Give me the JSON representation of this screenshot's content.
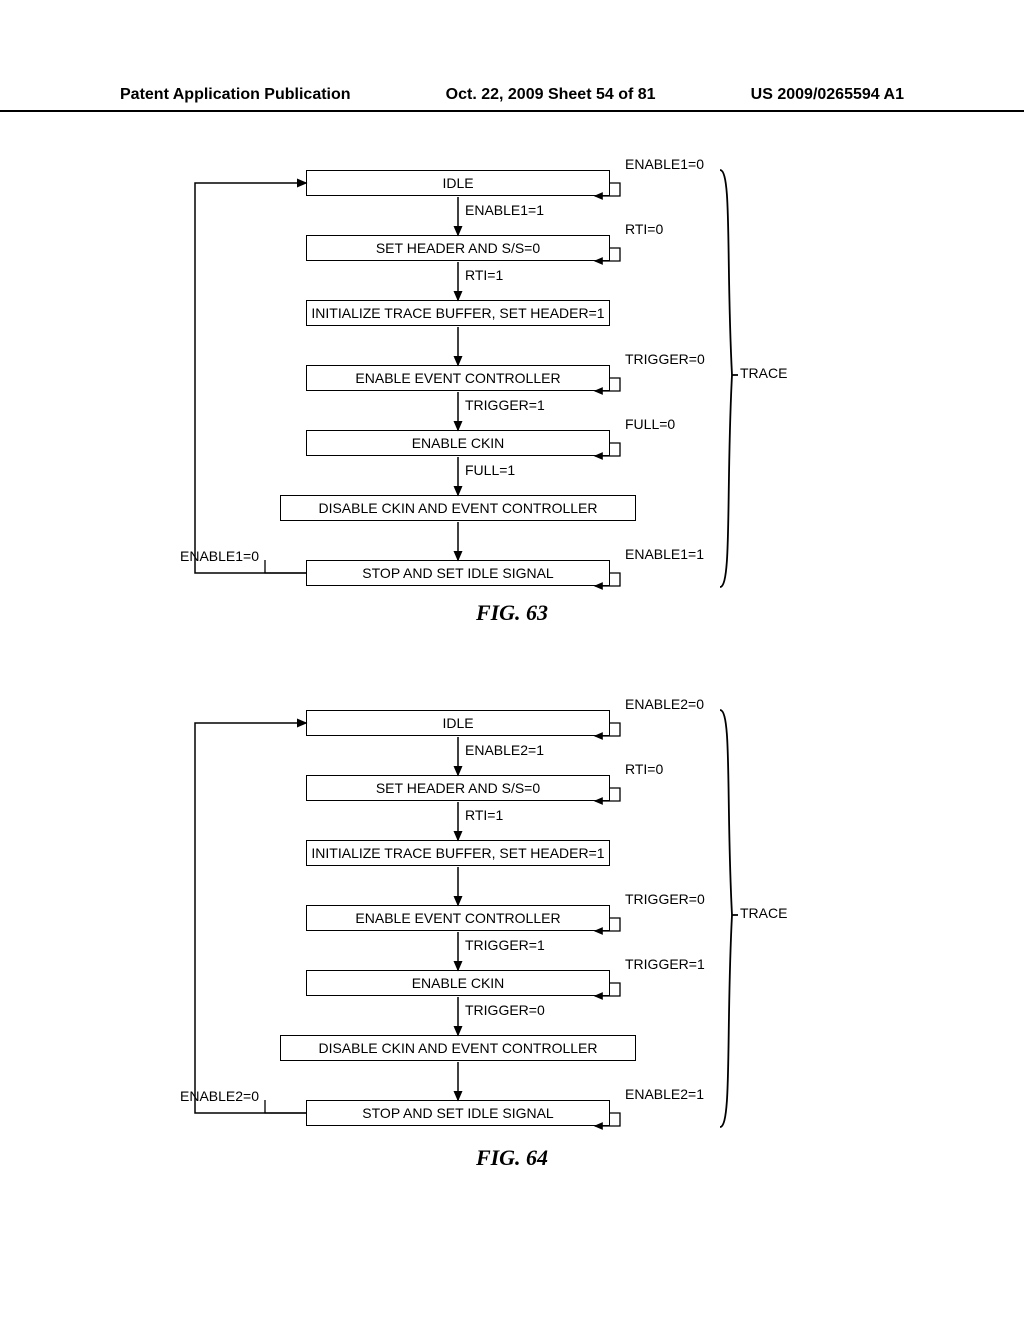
{
  "header": {
    "left": "Patent Application Publication",
    "center": "Oct. 22, 2009  Sheet 54 of 81",
    "right": "US 2009/0265594 A1"
  },
  "fig63": {
    "caption": "FIG. 63",
    "brace_label": "TRACE",
    "states": [
      "IDLE",
      "SET HEADER AND S/S=0",
      "INITIALIZE TRACE BUFFER, SET HEADER=1",
      "ENABLE EVENT CONTROLLER",
      "ENABLE CKIN",
      "DISABLE CKIN AND EVENT CONTROLLER",
      "STOP AND SET IDLE SIGNAL"
    ],
    "transitions": [
      "ENABLE1=1",
      "RTI=1",
      "TRIGGER=1",
      "FULL=1"
    ],
    "loops": [
      "ENABLE1=0",
      "RTI=0",
      "TRIGGER=0",
      "FULL=0",
      "ENABLE1=1"
    ],
    "feedback": "ENABLE1=0"
  },
  "fig64": {
    "caption": "FIG. 64",
    "brace_label": "TRACE",
    "states": [
      "IDLE",
      "SET HEADER AND S/S=0",
      "INITIALIZE TRACE BUFFER, SET HEADER=1",
      "ENABLE EVENT CONTROLLER",
      "ENABLE CKIN",
      "DISABLE CKIN AND EVENT CONTROLLER",
      "STOP AND SET IDLE SIGNAL"
    ],
    "transitions": [
      "ENABLE2=1",
      "RTI=1",
      "TRIGGER=1",
      "TRIGGER=0"
    ],
    "loops": [
      "ENABLE2=0",
      "RTI=0",
      "TRIGGER=0",
      "TRIGGER=1",
      "ENABLE2=1"
    ],
    "feedback": "ENABLE2=0"
  }
}
